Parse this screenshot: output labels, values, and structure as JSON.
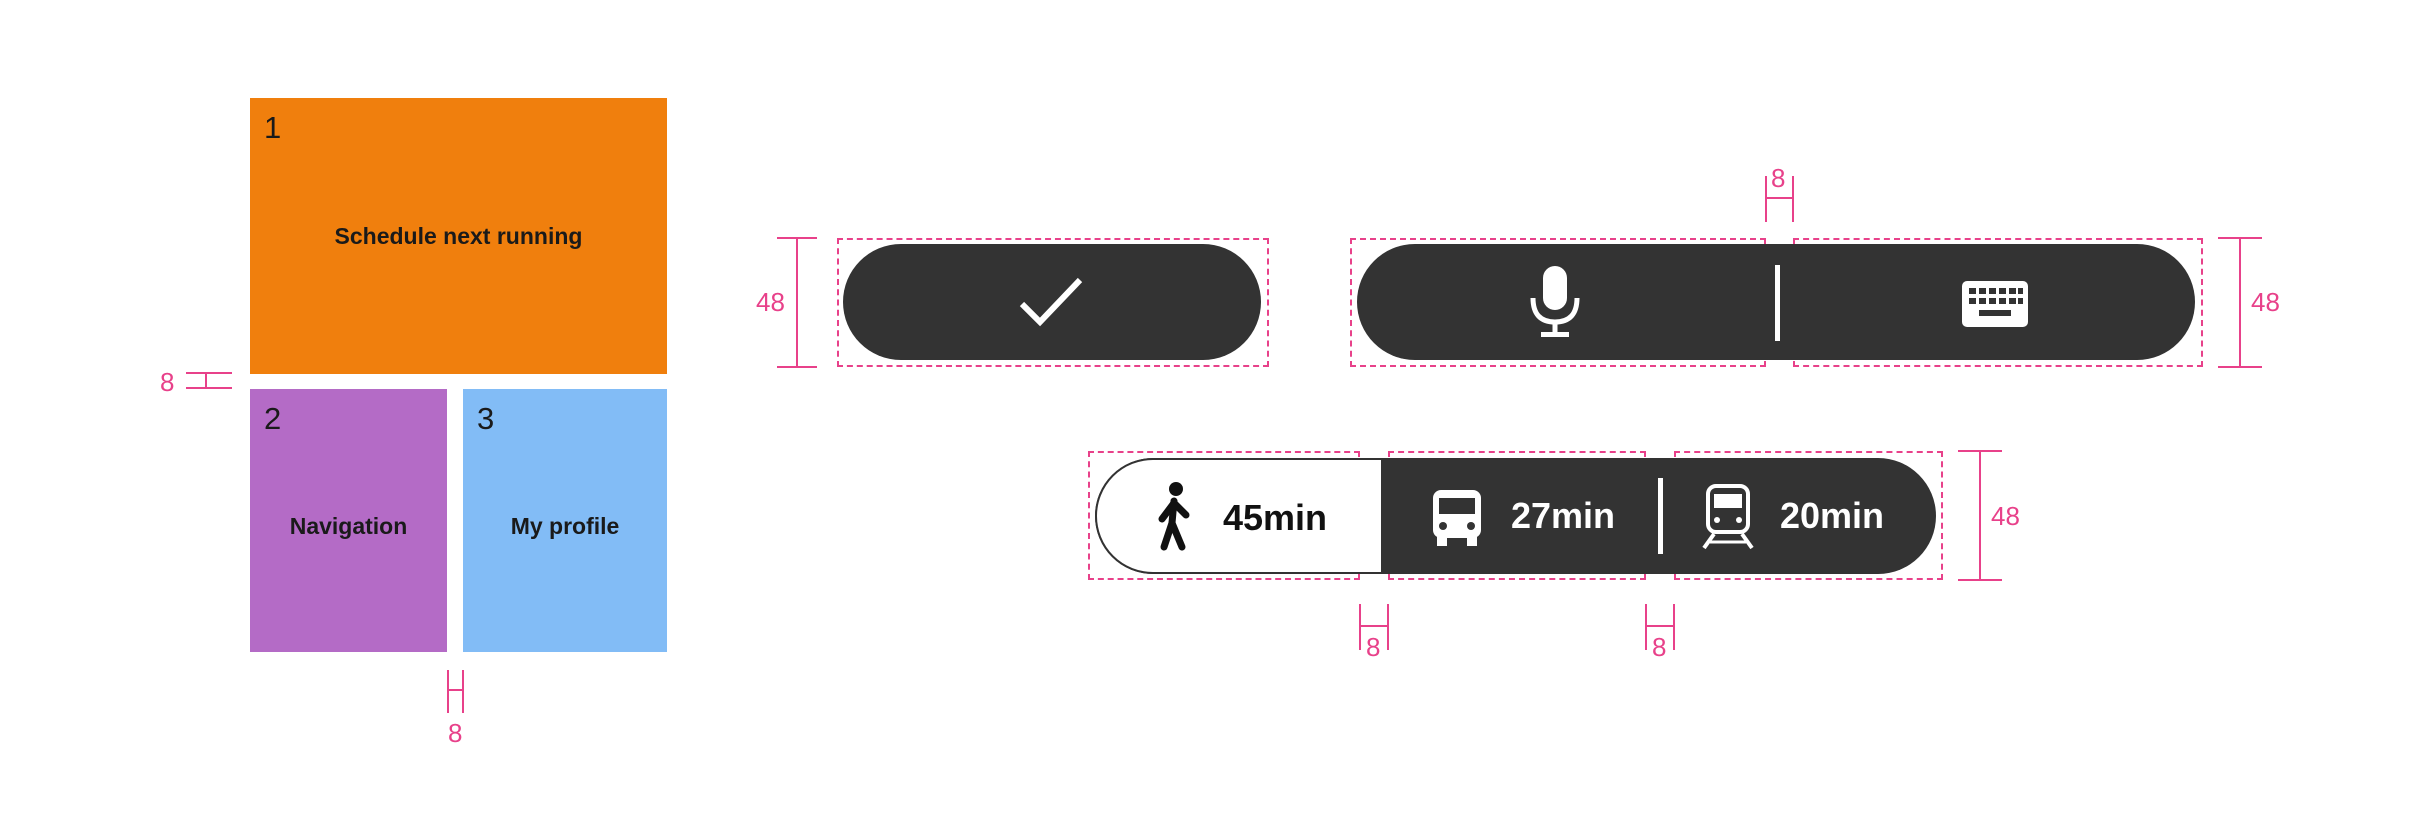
{
  "colors": {
    "tile1": "#f07f0d",
    "tile2": "#b46bc6",
    "tile3": "#82bcf6",
    "pill": "#333333",
    "annotation": "#e8418a"
  },
  "tiles": [
    {
      "number": "1",
      "label": "Schedule next running"
    },
    {
      "number": "2",
      "label": "Navigation"
    },
    {
      "number": "3",
      "label": "My profile"
    }
  ],
  "buttons": {
    "confirm_icon": "check-icon",
    "voice_icon": "microphone-icon",
    "keyboard_icon": "keyboard-icon"
  },
  "transport": {
    "walk": {
      "icon": "walk-icon",
      "time": "45min"
    },
    "bus": {
      "icon": "bus-icon",
      "time": "27min"
    },
    "train": {
      "icon": "train-icon",
      "time": "20min"
    }
  },
  "dimensions": {
    "tile_gap_vertical": "8",
    "tile_gap_horizontal": "8",
    "confirm_height": "48",
    "voice_gap": "8",
    "voice_height": "48",
    "transport_gap_1": "8",
    "transport_gap_2": "8",
    "transport_height": "48"
  }
}
